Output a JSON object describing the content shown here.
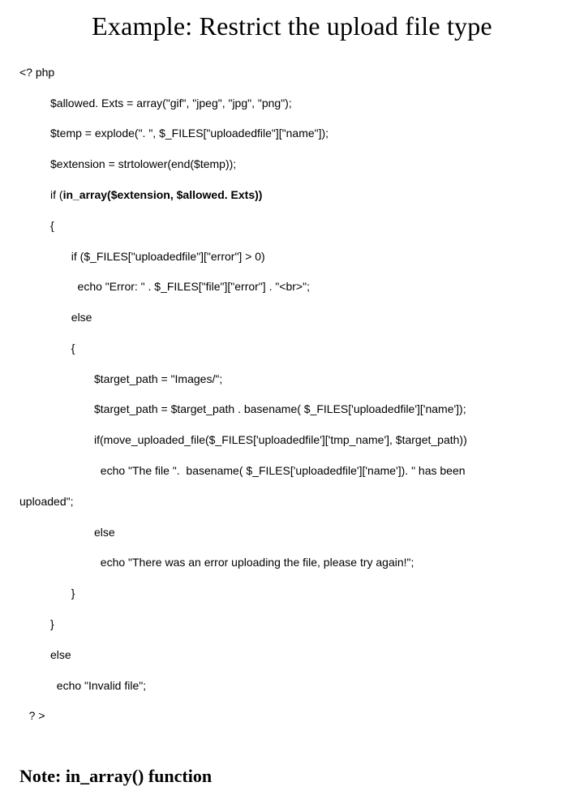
{
  "title": "Example: Restrict the upload file type",
  "code": {
    "l1": "<? php",
    "l2": "$allowed. Exts = array(\"gif\", \"jpeg\", \"jpg\", \"png\");",
    "l3": "$temp = explode(\". \", $_FILES[\"uploadedfile\"][\"name\"]);",
    "l4": "$extension = strtolower(end($temp));",
    "l5a": "if (",
    "l5b": "in_array($extension, $allowed. Exts))",
    "l6": "{",
    "l7": "  if ($_FILES[\"uploadedfile\"][\"error\"] > 0)",
    "l8": "    echo \"Error: \" . $_FILES[\"file\"][\"error\"] . \"<br>\";",
    "l9": "  else",
    "l10": "  {",
    "l11": "$target_path = \"Images/\";",
    "l12": "$target_path = $target_path . basename( $_FILES['uploadedfile']['name']);",
    "l13": "if(move_uploaded_file($_FILES['uploadedfile']['tmp_name'], $target_path))",
    "l14": "  echo \"The file \".  basename( $_FILES['uploadedfile']['name']). \" has been",
    "l15": "uploaded\";",
    "l16": "else",
    "l17": "  echo \"There was an error uploading the file, please try again!\";",
    "l18": "  }",
    "l19": "}",
    "l20": "else",
    "l21": "  echo \"Invalid file\";",
    "l22": "? >"
  },
  "note_prefix": "Note: ",
  "note_func": "in_array() function"
}
